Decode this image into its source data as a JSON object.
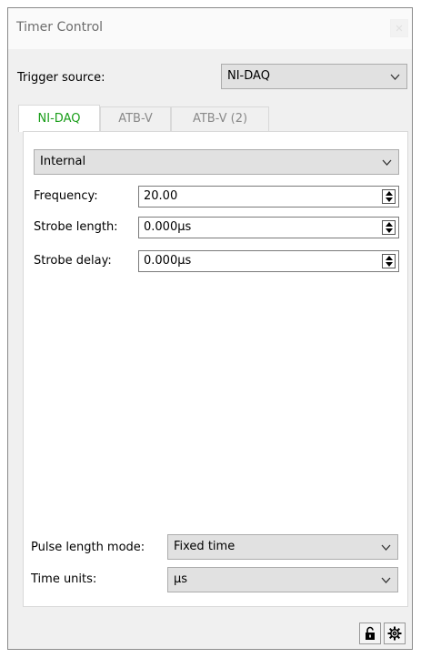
{
  "window": {
    "title": "Timer Control",
    "close_glyph": "✕"
  },
  "trigger": {
    "label": "Trigger source:",
    "value": "NI-DAQ"
  },
  "tabs": [
    {
      "label": "NI-DAQ",
      "active": true
    },
    {
      "label": "ATB-V",
      "active": false
    },
    {
      "label": "ATB-V (2)",
      "active": false
    }
  ],
  "nidaq": {
    "mode_value": "Internal",
    "frequency": {
      "label": "Frequency:",
      "value": "20.00"
    },
    "strobe_length": {
      "label": "Strobe length:",
      "value": "0.000µs"
    },
    "strobe_delay": {
      "label": "Strobe delay:",
      "value": "0.000µs"
    }
  },
  "pulse_length_mode": {
    "label": "Pulse length mode:",
    "value": "Fixed time"
  },
  "time_units": {
    "label": "Time units:",
    "value": "µs"
  },
  "bottom_buttons": [
    {
      "icon": "lock-icon"
    },
    {
      "icon": "gear-icon"
    }
  ],
  "colors": {
    "active_tab": "#1a9e1a",
    "panel_bg": "#f0f0f0"
  }
}
